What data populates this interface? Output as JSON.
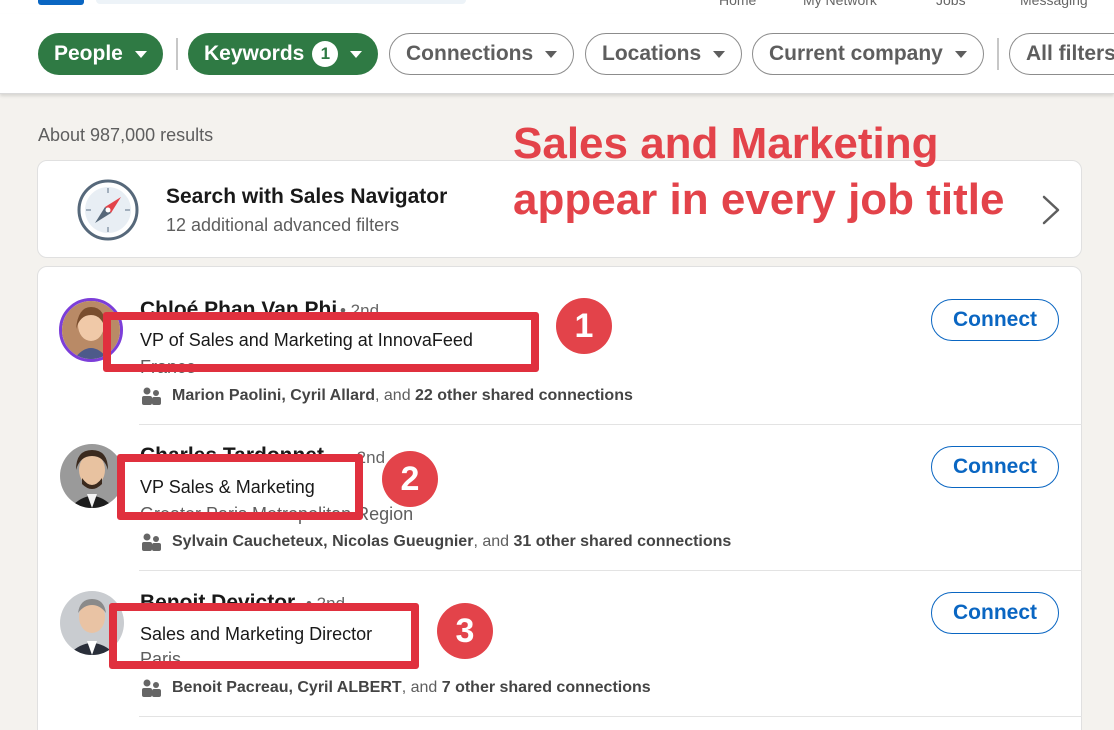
{
  "header": {
    "nav": [
      "Home",
      "My Network",
      "Jobs",
      "Messaging"
    ]
  },
  "filters": {
    "people": "People",
    "keywords": "Keywords",
    "keywords_count": "1",
    "connections": "Connections",
    "locations": "Locations",
    "current_company": "Current company",
    "all_filters": "All filters"
  },
  "results_count": "About 987,000 results",
  "annotation": {
    "line1": "Sales and Marketing",
    "line2": "appear in every job title"
  },
  "sales_navigator": {
    "title": "Search with Sales Navigator",
    "subtitle": "12 additional advanced filters"
  },
  "people": [
    {
      "name": "Chloé Phan Van Phi",
      "degree": "• 2nd",
      "headline": "VP of Sales and Marketing at InnovaFeed",
      "location": "France",
      "shared_names": "Marion Paolini, Cyril Allard",
      "shared_and": ", and ",
      "shared_count": "22 other shared connections",
      "connect": "Connect",
      "badge": "1"
    },
    {
      "name": "Charles Tardonnet",
      "degree": "• 2nd",
      "headline": "VP Sales & Marketing",
      "location": "Greater Paris Metropolitan Region",
      "shared_names": "Sylvain Caucheteux, Nicolas Gueugnier",
      "shared_and": ", and ",
      "shared_count": "31 other shared connections",
      "connect": "Connect",
      "badge": "2"
    },
    {
      "name": "Benoit Devictor",
      "degree": "• 2nd",
      "headline": "Sales and Marketing Director",
      "location": "Paris",
      "shared_names": "Benoit Pacreau, Cyril ALBERT",
      "shared_and": ", and ",
      "shared_count": "7 other shared connections",
      "connect": "Connect",
      "badge": "3"
    }
  ],
  "colors": {
    "active_filter": "#2f7a44",
    "primary_blue": "#0a66c2",
    "annotation_red": "#e3434a"
  },
  "icons": {
    "sales_navigator": "compass-icon",
    "chevron": "chevron-right-icon",
    "shared": "people-icon"
  }
}
